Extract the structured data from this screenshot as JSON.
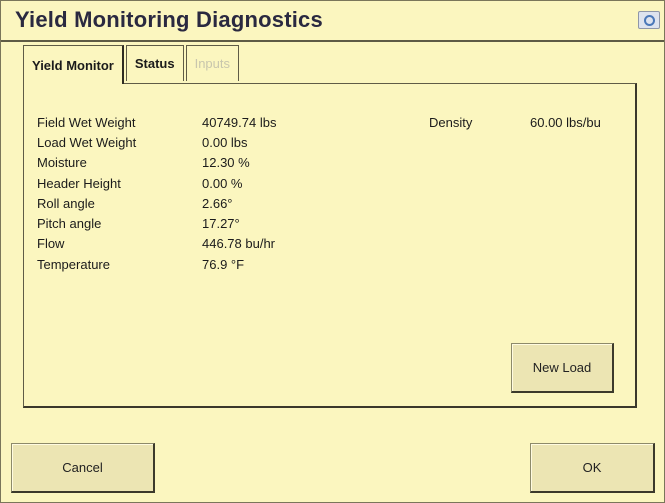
{
  "window": {
    "title": "Yield Monitoring Diagnostics",
    "corner_icon": "settings-window-icon"
  },
  "tabs": [
    {
      "label": "Yield Monitor",
      "state": "active"
    },
    {
      "label": "Status",
      "state": "normal"
    },
    {
      "label": "Inputs",
      "state": "disabled"
    }
  ],
  "readings": [
    {
      "label": "Field Wet Weight",
      "value": "40749.74 lbs"
    },
    {
      "label": "Load Wet Weight",
      "value": "0.00 lbs"
    },
    {
      "label": "Moisture",
      "value": "12.30 %"
    },
    {
      "label": "Header Height",
      "value": "0.00 %"
    },
    {
      "label": "Roll angle",
      "value": "2.66°"
    },
    {
      "label": "Pitch angle",
      "value": "17.27°"
    },
    {
      "label": "Flow",
      "value": "446.78 bu/hr"
    },
    {
      "label": "Temperature",
      "value": "76.9 °F"
    }
  ],
  "density": {
    "label": "Density",
    "value": "60.00 lbs/bu"
  },
  "buttons": {
    "new_load": "New Load",
    "cancel": "Cancel",
    "ok": "OK"
  }
}
